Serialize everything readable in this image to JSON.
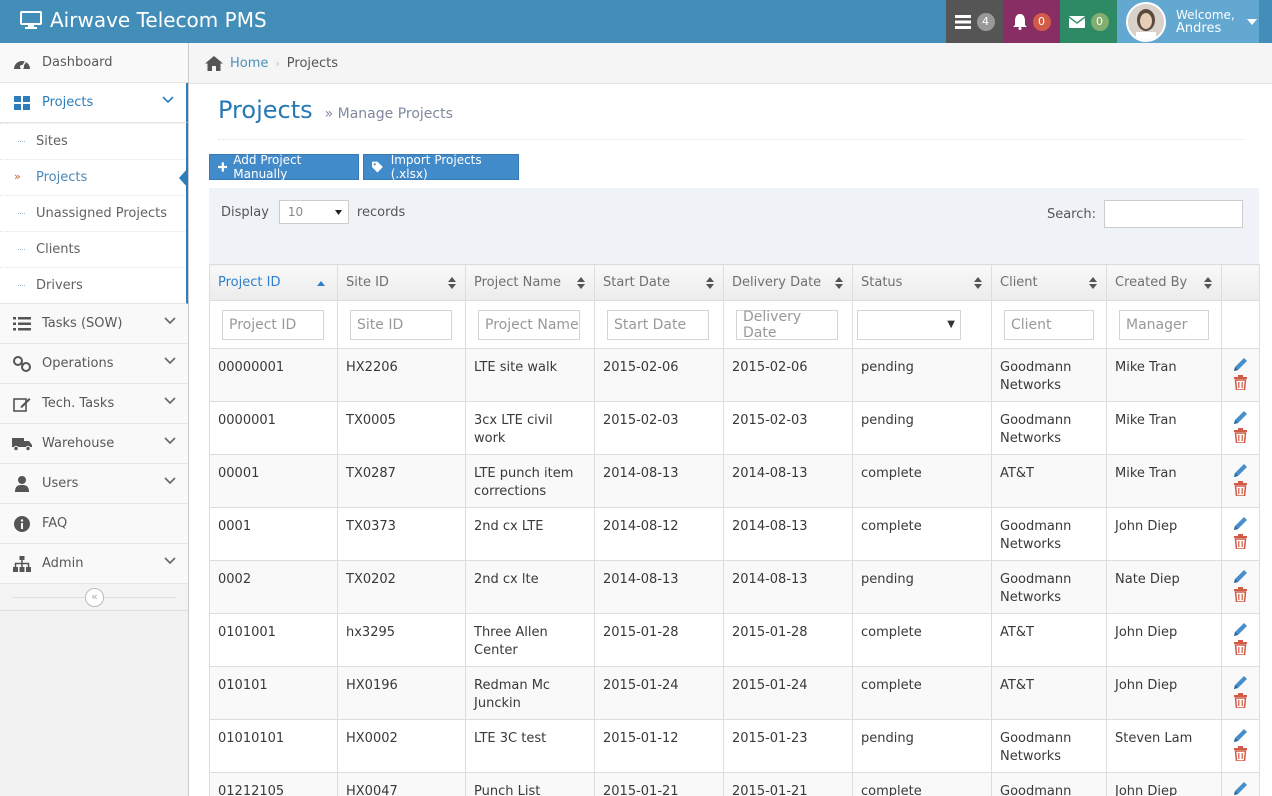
{
  "app": {
    "title": "Airwave Telecom PMS"
  },
  "navbar": {
    "tasks_count": "4",
    "notifications_count": "0",
    "messages_count": "0",
    "welcome": "Welcome,",
    "username": "Andres"
  },
  "sidebar": {
    "items": [
      {
        "label": "Dashboard",
        "icon": "dashboard-icon"
      },
      {
        "label": "Projects",
        "icon": "grid-icon"
      },
      {
        "label": "Tasks (SOW)",
        "icon": "list-icon"
      },
      {
        "label": "Operations",
        "icon": "link-icon"
      },
      {
        "label": "Tech. Tasks",
        "icon": "edit-icon"
      },
      {
        "label": "Warehouse",
        "icon": "truck-icon"
      },
      {
        "label": "Users",
        "icon": "user-icon"
      },
      {
        "label": "FAQ",
        "icon": "info-icon"
      },
      {
        "label": "Admin",
        "icon": "sitemap-icon"
      }
    ],
    "subitems": [
      "Sites",
      "Projects",
      "Unassigned Projects",
      "Clients",
      "Drivers"
    ]
  },
  "breadcrumb": {
    "home": "Home",
    "current": "Projects"
  },
  "page": {
    "title": "Projects",
    "subtitle": "Manage Projects"
  },
  "buttons": {
    "add": "Add Project Manually",
    "import": "Import Projects (.xlsx)"
  },
  "table_controls": {
    "display_label": "Display",
    "display_value": "10",
    "records_label": "records",
    "search_label": "Search:"
  },
  "table": {
    "columns": [
      "Project ID",
      "Site ID",
      "Project Name",
      "Start Date",
      "Delivery Date",
      "Status",
      "Client",
      "Created By"
    ],
    "filters": [
      "Project ID",
      "Site ID",
      "Project Name",
      "Start Date",
      "Delivery Date",
      "",
      "Client",
      "Manager"
    ],
    "rows": [
      {
        "project_id": "00000001",
        "site_id": "HX2206",
        "name": "LTE site walk",
        "start": "2015-02-06",
        "delivery": "2015-02-06",
        "status": "pending",
        "client": "Goodmann Networks",
        "created_by": "Mike Tran"
      },
      {
        "project_id": "0000001",
        "site_id": "TX0005",
        "name": "3cx LTE civil work",
        "start": "2015-02-03",
        "delivery": "2015-02-03",
        "status": "pending",
        "client": "Goodmann Networks",
        "created_by": "Mike Tran"
      },
      {
        "project_id": "00001",
        "site_id": "TX0287",
        "name": "LTE punch item corrections",
        "start": "2014-08-13",
        "delivery": "2014-08-13",
        "status": "complete",
        "client": "AT&T",
        "created_by": "Mike Tran"
      },
      {
        "project_id": "0001",
        "site_id": "TX0373",
        "name": "2nd cx LTE",
        "start": "2014-08-12",
        "delivery": "2014-08-13",
        "status": "complete",
        "client": "Goodmann Networks",
        "created_by": "John Diep"
      },
      {
        "project_id": "0002",
        "site_id": "TX0202",
        "name": "2nd cx lte",
        "start": "2014-08-13",
        "delivery": "2014-08-13",
        "status": "pending",
        "client": "Goodmann Networks",
        "created_by": "Nate Diep"
      },
      {
        "project_id": "0101001",
        "site_id": "hx3295",
        "name": "Three Allen Center",
        "start": "2015-01-28",
        "delivery": "2015-01-28",
        "status": "complete",
        "client": "AT&T",
        "created_by": "John Diep"
      },
      {
        "project_id": "010101",
        "site_id": "HX0196",
        "name": "Redman Mc Junckin",
        "start": "2015-01-24",
        "delivery": "2015-01-24",
        "status": "complete",
        "client": "AT&T",
        "created_by": "John Diep"
      },
      {
        "project_id": "01010101",
        "site_id": "HX0002",
        "name": "LTE 3C test",
        "start": "2015-01-12",
        "delivery": "2015-01-23",
        "status": "pending",
        "client": "Goodmann Networks",
        "created_by": "Steven Lam"
      },
      {
        "project_id": "01212105",
        "site_id": "HX0047",
        "name": "Punch List",
        "start": "2015-01-21",
        "delivery": "2015-01-21",
        "status": "complete",
        "client": "Goodmann Networks",
        "created_by": "John Diep"
      }
    ]
  },
  "colors": {
    "navbar": "#438eb9",
    "accent": "#2b7dbc",
    "delete": "#d15b47"
  }
}
